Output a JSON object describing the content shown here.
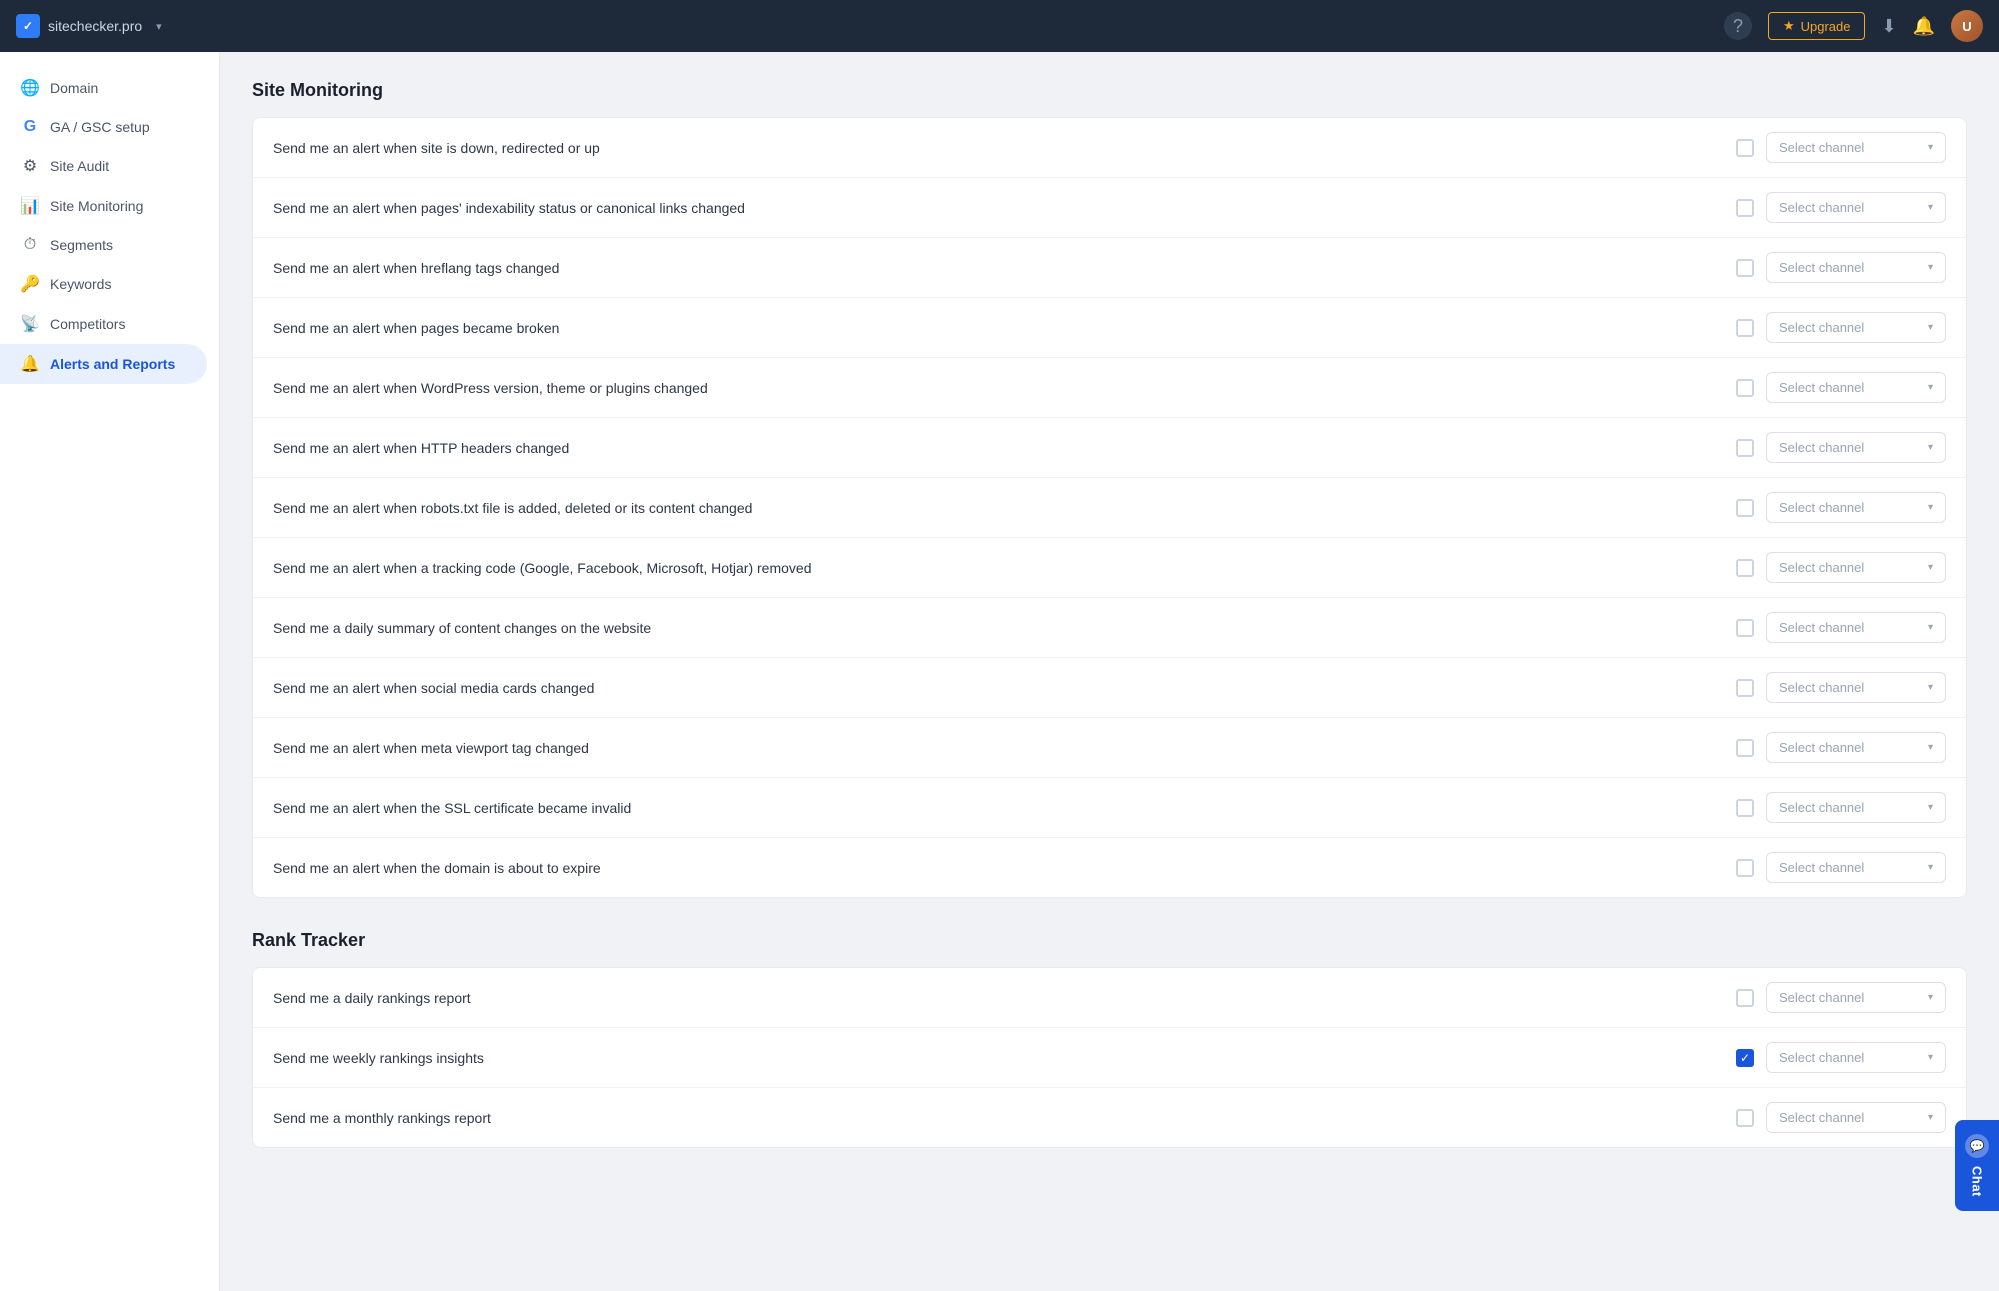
{
  "topnav": {
    "site": "sitechecker.pro",
    "upgrade_label": "Upgrade",
    "help_icon": "?",
    "download_icon": "⬇",
    "bell_icon": "🔔",
    "avatar_label": "U"
  },
  "sidebar": {
    "items": [
      {
        "id": "domain",
        "label": "Domain",
        "icon": "🌐",
        "active": false
      },
      {
        "id": "ga-gsc",
        "label": "GA / GSC setup",
        "icon": "G",
        "active": false
      },
      {
        "id": "site-audit",
        "label": "Site Audit",
        "icon": "⚙",
        "active": false
      },
      {
        "id": "site-monitoring",
        "label": "Site Monitoring",
        "icon": "📊",
        "active": false
      },
      {
        "id": "segments",
        "label": "Segments",
        "icon": "⏱",
        "active": false
      },
      {
        "id": "keywords",
        "label": "Keywords",
        "icon": "🔑",
        "active": false
      },
      {
        "id": "competitors",
        "label": "Competitors",
        "icon": "📡",
        "active": false
      },
      {
        "id": "alerts-reports",
        "label": "Alerts and Reports",
        "icon": "🔔",
        "active": true
      }
    ]
  },
  "site_monitoring": {
    "section_title": "Site Monitoring",
    "alerts": [
      {
        "id": "sm1",
        "label": "Send me an alert when site is down, redirected or up",
        "checked": false
      },
      {
        "id": "sm2",
        "label": "Send me an alert when pages' indexability status or canonical links changed",
        "checked": false
      },
      {
        "id": "sm3",
        "label": "Send me an alert when hreflang tags changed",
        "checked": false
      },
      {
        "id": "sm4",
        "label": "Send me an alert when pages became broken",
        "checked": false
      },
      {
        "id": "sm5",
        "label": "Send me an alert when WordPress version, theme or plugins changed",
        "checked": false
      },
      {
        "id": "sm6",
        "label": "Send me an alert when HTTP headers changed",
        "checked": false
      },
      {
        "id": "sm7",
        "label": "Send me an alert when robots.txt file is added, deleted or its content changed",
        "checked": false
      },
      {
        "id": "sm8",
        "label": "Send me an alert when a tracking code (Google, Facebook, Microsoft, Hotjar) removed",
        "checked": false
      },
      {
        "id": "sm9",
        "label": "Send me a daily summary of content changes on the website",
        "checked": false
      },
      {
        "id": "sm10",
        "label": "Send me an alert when social media cards changed",
        "checked": false
      },
      {
        "id": "sm11",
        "label": "Send me an alert when meta viewport tag changed",
        "checked": false
      },
      {
        "id": "sm12",
        "label": "Send me an alert when the SSL certificate became invalid",
        "checked": false
      },
      {
        "id": "sm13",
        "label": "Send me an alert when the domain is about to expire",
        "checked": false
      }
    ]
  },
  "rank_tracker": {
    "section_title": "Rank Tracker",
    "alerts": [
      {
        "id": "rt1",
        "label": "Send me a daily rankings report",
        "checked": false
      },
      {
        "id": "rt2",
        "label": "Send me weekly rankings insights",
        "checked": true
      },
      {
        "id": "rt3",
        "label": "Send me a monthly rankings report",
        "checked": false
      }
    ]
  },
  "select_channel": {
    "placeholder": "Select channel",
    "chevron": "▾"
  },
  "chat": {
    "label": "Chat",
    "icon": "💬"
  }
}
